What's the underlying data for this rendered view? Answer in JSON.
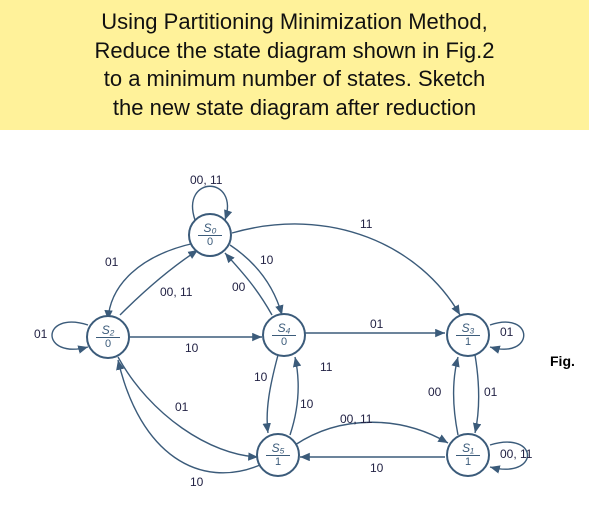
{
  "header": {
    "line1": "Using Partitioning Minimization Method,",
    "line2": "Reduce the state diagram shown in Fig.2",
    "line3": "to a minimum number of states. Sketch",
    "line4": "the new state diagram after reduction"
  },
  "figure_label": "Fig.",
  "states": {
    "s0": {
      "name": "S₀",
      "output": "0"
    },
    "s2": {
      "name": "S₂",
      "output": "0"
    },
    "s4": {
      "name": "S₄",
      "output": "0"
    },
    "s3": {
      "name": "S₃",
      "output": "1"
    },
    "s5": {
      "name": "S₅",
      "output": "1"
    },
    "s1": {
      "name": "S₁",
      "output": "1"
    }
  },
  "edge_labels": {
    "s0_self": "00, 11",
    "s0_s2": "01",
    "s0_s4": "10",
    "s2_self": "01",
    "s2_s0": "00, 11",
    "s2_s4": "10",
    "s4_s0": "00",
    "s4_s5_a": "10",
    "s4_s5_b": "11",
    "s4_s3": "01",
    "s3_self": "01",
    "s3_s1": "00",
    "s0_s3_arc": "11",
    "s5_s4": "10",
    "s5_s1": "00, 11",
    "s2_s5": "01",
    "s1_self": "00, 11",
    "s1_s3": "01",
    "s1_s5": "10",
    "s5_s2_back": "10"
  }
}
